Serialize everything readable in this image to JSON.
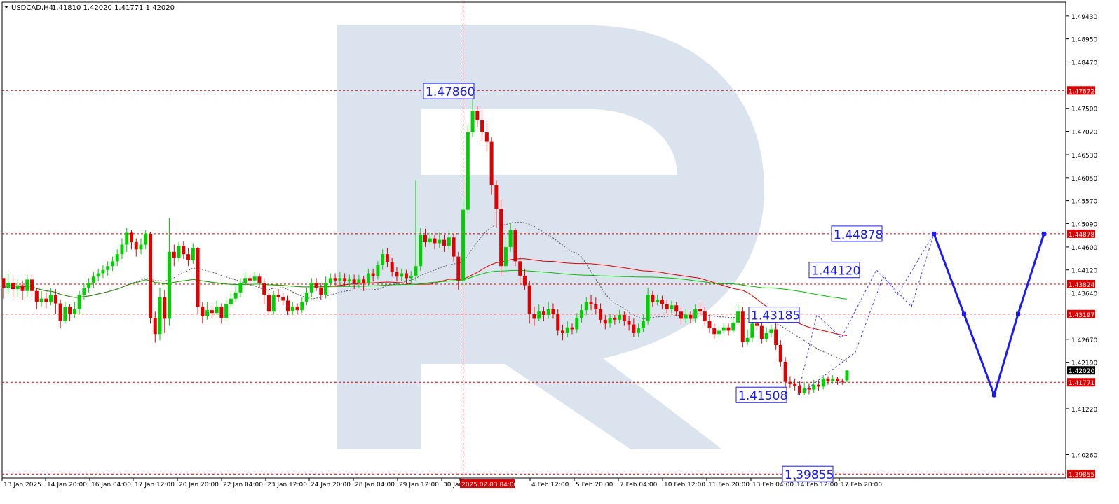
{
  "header": {
    "symbol": "USDCAD,H4",
    "ohlc": "1.41810 1.42020 1.41771 1.42020"
  },
  "chart_data": {
    "type": "candlestick",
    "symbol": "USDCAD",
    "timeframe": "H4",
    "ylim": [
      1.3977,
      1.4972
    ],
    "grid": false,
    "y_ticks": [
      "1.49430",
      "1.48950",
      "1.48470",
      "1.47500",
      "1.47020",
      "1.46530",
      "1.46050",
      "1.45570",
      "1.45090",
      "1.44600",
      "1.44120",
      "1.43640",
      "1.42670",
      "1.42190",
      "1.41220",
      "1.40260"
    ],
    "x_ticks": [
      "13 Jan 2025",
      "14 Jan 20:00",
      "16 Jan 04:00",
      "17 Jan 12:00",
      "20 Jan 20:00",
      "22 Jan 04:00",
      "23 Jan 12:00",
      "24 Jan 20:00",
      "28 Jan 04:00",
      "29 Jan 12:00",
      "30 Jan 20:00",
      "2025.02.03 04:00",
      "4 Feb 12:00",
      "5 Feb 20:00",
      "7 Feb 04:00",
      "10 Feb 12:00",
      "11 Feb 20:00",
      "13 Feb 04:00",
      "14 Feb 12:00",
      "17 Feb 20:00"
    ],
    "crosshair_time": "2025.02.03 04:00",
    "horizontal_levels": [
      {
        "value": 1.47872,
        "label": "1.47872",
        "color": "#e00000"
      },
      {
        "value": 1.44878,
        "label": "1.44878",
        "color": "#e00000"
      },
      {
        "value": 1.43824,
        "label": "1.43824",
        "color": "#e00000"
      },
      {
        "value": 1.43197,
        "label": "1.43197",
        "color": "#e00000"
      },
      {
        "value": 1.41771,
        "label": "1.41771",
        "color": "#e00000"
      },
      {
        "value": 1.39855,
        "label": "1.39855",
        "color": "#e00000"
      }
    ],
    "current_price": {
      "value": 1.4202,
      "label": "1.42020"
    },
    "annotations": [
      {
        "text": "1.47860",
        "value": 1.4786
      },
      {
        "text": "1.44878",
        "value": 1.44878
      },
      {
        "text": "1.44120",
        "value": 1.4412
      },
      {
        "text": "1.43185",
        "value": 1.43185
      },
      {
        "text": "1.41508",
        "value": 1.41508
      },
      {
        "text": "1.39855",
        "value": 1.39855
      }
    ],
    "forecast_path": [
      1.41508,
      1.44878,
      1.43197,
      1.41508,
      1.43197,
      1.44878
    ],
    "candles": [
      [
        1.4395,
        1.4375,
        1.4395,
        1.4352
      ],
      [
        1.4375,
        1.4385,
        1.4405,
        1.4362
      ],
      [
        1.4385,
        1.4372,
        1.4398,
        1.4355
      ],
      [
        1.4372,
        1.438,
        1.4393,
        1.4355
      ],
      [
        1.438,
        1.4368,
        1.439,
        1.435
      ],
      [
        1.4368,
        1.4392,
        1.4402,
        1.4355
      ],
      [
        1.4392,
        1.4368,
        1.4403,
        1.4355
      ],
      [
        1.4368,
        1.4345,
        1.4375,
        1.433
      ],
      [
        1.4345,
        1.4352,
        1.4368,
        1.4335
      ],
      [
        1.4352,
        1.4345,
        1.4365,
        1.4332
      ],
      [
        1.4345,
        1.436,
        1.4375,
        1.4338
      ],
      [
        1.436,
        1.4342,
        1.4372,
        1.432
      ],
      [
        1.4342,
        1.4305,
        1.435,
        1.429
      ],
      [
        1.4305,
        1.4335,
        1.4345,
        1.43
      ],
      [
        1.4335,
        1.432,
        1.434,
        1.4305
      ],
      [
        1.432,
        1.433,
        1.4345,
        1.4312
      ],
      [
        1.433,
        1.436,
        1.4368,
        1.432
      ],
      [
        1.436,
        1.4375,
        1.4385,
        1.435
      ],
      [
        1.4375,
        1.4385,
        1.4395,
        1.4365
      ],
      [
        1.4385,
        1.4398,
        1.4408,
        1.4375
      ],
      [
        1.4398,
        1.4405,
        1.4415,
        1.4388
      ],
      [
        1.4405,
        1.4412,
        1.4422,
        1.4395
      ],
      [
        1.4412,
        1.442,
        1.443,
        1.44
      ],
      [
        1.442,
        1.443,
        1.444,
        1.441
      ],
      [
        1.443,
        1.4445,
        1.4455,
        1.442
      ],
      [
        1.4445,
        1.4465,
        1.4478,
        1.4435
      ],
      [
        1.4465,
        1.449,
        1.45,
        1.445
      ],
      [
        1.449,
        1.447,
        1.4495,
        1.4455
      ],
      [
        1.447,
        1.4455,
        1.4478,
        1.444
      ],
      [
        1.4455,
        1.4465,
        1.4478,
        1.4445
      ],
      [
        1.4465,
        1.4488,
        1.4495,
        1.4455
      ],
      [
        1.4488,
        1.4312,
        1.4492,
        1.43
      ],
      [
        1.4312,
        1.4278,
        1.4325,
        1.426
      ],
      [
        1.4278,
        1.4355,
        1.4375,
        1.4265
      ],
      [
        1.4355,
        1.431,
        1.437,
        1.428
      ],
      [
        1.431,
        1.445,
        1.452,
        1.4295
      ],
      [
        1.445,
        1.4438,
        1.4465,
        1.442
      ],
      [
        1.4438,
        1.4462,
        1.447,
        1.443
      ],
      [
        1.4462,
        1.4445,
        1.4472,
        1.4435
      ],
      [
        1.4445,
        1.4432,
        1.4458,
        1.442
      ],
      [
        1.4432,
        1.4458,
        1.4468,
        1.4425
      ],
      [
        1.4458,
        1.4335,
        1.446,
        1.432
      ],
      [
        1.4335,
        1.4315,
        1.4345,
        1.43
      ],
      [
        1.4315,
        1.4328,
        1.4345,
        1.4308
      ],
      [
        1.4328,
        1.4322,
        1.4338,
        1.431
      ],
      [
        1.4322,
        1.4335,
        1.4348,
        1.4318
      ],
      [
        1.4335,
        1.4312,
        1.4342,
        1.43
      ],
      [
        1.4312,
        1.434,
        1.435,
        1.4305
      ],
      [
        1.434,
        1.4352,
        1.4365,
        1.4335
      ],
      [
        1.4352,
        1.4365,
        1.4378,
        1.4345
      ],
      [
        1.4365,
        1.4385,
        1.4395,
        1.4355
      ],
      [
        1.4385,
        1.4395,
        1.4408,
        1.4378
      ],
      [
        1.4395,
        1.439,
        1.4402,
        1.438
      ],
      [
        1.439,
        1.4398,
        1.4408,
        1.4382
      ],
      [
        1.4398,
        1.4385,
        1.4405,
        1.4375
      ],
      [
        1.4385,
        1.436,
        1.4395,
        1.434
      ],
      [
        1.436,
        1.4325,
        1.437,
        1.4315
      ],
      [
        1.4325,
        1.436,
        1.4368,
        1.4318
      ],
      [
        1.436,
        1.4355,
        1.4372,
        1.4345
      ],
      [
        1.4355,
        1.4348,
        1.4365,
        1.4338
      ],
      [
        1.4348,
        1.4325,
        1.4358,
        1.4318
      ],
      [
        1.4325,
        1.4335,
        1.4345,
        1.4318
      ],
      [
        1.4335,
        1.4328,
        1.4342,
        1.432
      ],
      [
        1.4328,
        1.4345,
        1.4355,
        1.4322
      ],
      [
        1.4345,
        1.4365,
        1.4375,
        1.4338
      ],
      [
        1.4365,
        1.4385,
        1.4395,
        1.4355
      ],
      [
        1.4385,
        1.4375,
        1.4395,
        1.4368
      ],
      [
        1.4375,
        1.436,
        1.4385,
        1.435
      ],
      [
        1.436,
        1.4385,
        1.4398,
        1.4352
      ],
      [
        1.4385,
        1.4395,
        1.4405,
        1.4378
      ],
      [
        1.4395,
        1.439,
        1.4405,
        1.438
      ],
      [
        1.439,
        1.4395,
        1.4408,
        1.4382
      ],
      [
        1.4395,
        1.4388,
        1.4405,
        1.4378
      ],
      [
        1.4388,
        1.4392,
        1.4402,
        1.4378
      ],
      [
        1.4392,
        1.4385,
        1.4402,
        1.4372
      ],
      [
        1.4385,
        1.4392,
        1.4402,
        1.4375
      ],
      [
        1.4392,
        1.4385,
        1.44,
        1.4368
      ],
      [
        1.4385,
        1.4405,
        1.4415,
        1.4378
      ],
      [
        1.4405,
        1.44,
        1.4415,
        1.4388
      ],
      [
        1.44,
        1.4422,
        1.443,
        1.4392
      ],
      [
        1.4422,
        1.4445,
        1.4455,
        1.4412
      ],
      [
        1.4445,
        1.4428,
        1.4458,
        1.4418
      ],
      [
        1.4428,
        1.4408,
        1.4438,
        1.4398
      ],
      [
        1.4408,
        1.4398,
        1.4418,
        1.4388
      ],
      [
        1.4398,
        1.4405,
        1.4415,
        1.4388
      ],
      [
        1.4405,
        1.4395,
        1.4412,
        1.4382
      ],
      [
        1.4395,
        1.44,
        1.441,
        1.4385
      ],
      [
        1.44,
        1.442,
        1.46,
        1.439
      ],
      [
        1.442,
        1.4485,
        1.45,
        1.441
      ],
      [
        1.4485,
        1.447,
        1.4498,
        1.446
      ],
      [
        1.447,
        1.4478,
        1.449,
        1.4465
      ],
      [
        1.4478,
        1.4468,
        1.4485,
        1.4455
      ],
      [
        1.4468,
        1.4475,
        1.449,
        1.4458
      ],
      [
        1.4475,
        1.4462,
        1.4485,
        1.445
      ],
      [
        1.4462,
        1.448,
        1.4495,
        1.4455
      ],
      [
        1.448,
        1.444,
        1.4488,
        1.443
      ],
      [
        1.444,
        1.439,
        1.445,
        1.437
      ],
      [
        1.439,
        1.4538,
        1.456,
        1.438
      ],
      [
        1.4538,
        1.47,
        1.4715,
        1.453
      ],
      [
        1.47,
        1.4745,
        1.4786,
        1.469
      ],
      [
        1.4745,
        1.4725,
        1.4755,
        1.471
      ],
      [
        1.4725,
        1.47,
        1.4748,
        1.468
      ],
      [
        1.47,
        1.468,
        1.472,
        1.466
      ],
      [
        1.468,
        1.459,
        1.469,
        1.457
      ],
      [
        1.459,
        1.454,
        1.46,
        1.45
      ],
      [
        1.454,
        1.442,
        1.456,
        1.44
      ],
      [
        1.442,
        1.446,
        1.448,
        1.441
      ],
      [
        1.446,
        1.4495,
        1.451,
        1.445
      ],
      [
        1.4495,
        1.443,
        1.45,
        1.442
      ],
      [
        1.443,
        1.44,
        1.444,
        1.438
      ],
      [
        1.44,
        1.438,
        1.4415,
        1.437
      ],
      [
        1.438,
        1.432,
        1.439,
        1.43
      ],
      [
        1.432,
        1.431,
        1.4335,
        1.4295
      ],
      [
        1.431,
        1.4325,
        1.434,
        1.4305
      ],
      [
        1.4325,
        1.4318,
        1.4335,
        1.4305
      ],
      [
        1.4318,
        1.433,
        1.4345,
        1.431
      ],
      [
        1.433,
        1.432,
        1.4342,
        1.431
      ],
      [
        1.432,
        1.4285,
        1.433,
        1.4275
      ],
      [
        1.4285,
        1.428,
        1.4298,
        1.4265
      ],
      [
        1.428,
        1.4292,
        1.4305,
        1.4272
      ],
      [
        1.4292,
        1.4288,
        1.43,
        1.4278
      ],
      [
        1.4288,
        1.4312,
        1.4322,
        1.428
      ],
      [
        1.4312,
        1.4328,
        1.434,
        1.4302
      ],
      [
        1.4328,
        1.4345,
        1.4355,
        1.4318
      ],
      [
        1.4345,
        1.434,
        1.436,
        1.4328
      ],
      [
        1.434,
        1.433,
        1.4355,
        1.432
      ],
      [
        1.433,
        1.4308,
        1.4342,
        1.43
      ],
      [
        1.4308,
        1.43,
        1.4318,
        1.4288
      ],
      [
        1.43,
        1.4312,
        1.432,
        1.4292
      ],
      [
        1.4312,
        1.4308,
        1.4318,
        1.4298
      ],
      [
        1.4308,
        1.4318,
        1.4328,
        1.43
      ],
      [
        1.4318,
        1.4305,
        1.4325,
        1.4295
      ],
      [
        1.4305,
        1.4298,
        1.4315,
        1.4285
      ],
      [
        1.4298,
        1.428,
        1.431,
        1.4272
      ],
      [
        1.428,
        1.429,
        1.43,
        1.4272
      ],
      [
        1.429,
        1.4305,
        1.4318,
        1.4282
      ],
      [
        1.4305,
        1.436,
        1.4375,
        1.4298
      ],
      [
        1.436,
        1.4345,
        1.4368,
        1.4335
      ],
      [
        1.4345,
        1.435,
        1.436,
        1.4338
      ],
      [
        1.435,
        1.434,
        1.4358,
        1.433
      ],
      [
        1.434,
        1.433,
        1.435,
        1.4322
      ],
      [
        1.433,
        1.4338,
        1.4348,
        1.4322
      ],
      [
        1.4338,
        1.4325,
        1.4345,
        1.4315
      ],
      [
        1.4325,
        1.431,
        1.4335,
        1.43
      ],
      [
        1.431,
        1.4318,
        1.433,
        1.4302
      ],
      [
        1.4318,
        1.431,
        1.4325,
        1.43
      ],
      [
        1.431,
        1.433,
        1.434,
        1.4302
      ],
      [
        1.433,
        1.4325,
        1.4345,
        1.4315
      ],
      [
        1.4325,
        1.4305,
        1.4335,
        1.4295
      ],
      [
        1.4305,
        1.429,
        1.4315,
        1.428
      ],
      [
        1.429,
        1.4278,
        1.43,
        1.4268
      ],
      [
        1.4278,
        1.4285,
        1.4295,
        1.427
      ],
      [
        1.4285,
        1.4292,
        1.4302,
        1.4278
      ],
      [
        1.4292,
        1.4285,
        1.43,
        1.4275
      ],
      [
        1.4285,
        1.4302,
        1.4312,
        1.428
      ],
      [
        1.4302,
        1.4325,
        1.434,
        1.4295
      ],
      [
        1.4325,
        1.4262,
        1.4335,
        1.425
      ],
      [
        1.4262,
        1.427,
        1.4288,
        1.4255
      ],
      [
        1.427,
        1.43,
        1.431,
        1.4262
      ],
      [
        1.43,
        1.4295,
        1.4312,
        1.4285
      ],
      [
        1.4295,
        1.4268,
        1.4305,
        1.4258
      ],
      [
        1.4268,
        1.428,
        1.4292,
        1.4262
      ],
      [
        1.428,
        1.4288,
        1.4298,
        1.4272
      ],
      [
        1.4288,
        1.4255,
        1.43,
        1.4245
      ],
      [
        1.4255,
        1.422,
        1.4265,
        1.421
      ],
      [
        1.422,
        1.4178,
        1.423,
        1.4165
      ],
      [
        1.4178,
        1.4175,
        1.419,
        1.4165
      ],
      [
        1.4175,
        1.417,
        1.4185,
        1.416
      ],
      [
        1.417,
        1.4155,
        1.418,
        1.415
      ],
      [
        1.4155,
        1.4165,
        1.4178,
        1.415
      ],
      [
        1.4165,
        1.4162,
        1.4175,
        1.4152
      ],
      [
        1.4162,
        1.4172,
        1.4182,
        1.4155
      ],
      [
        1.4172,
        1.4168,
        1.418,
        1.416
      ],
      [
        1.4168,
        1.4185,
        1.4192,
        1.4162
      ],
      [
        1.4185,
        1.418,
        1.419,
        1.4172
      ],
      [
        1.418,
        1.4185,
        1.4192,
        1.4175
      ],
      [
        1.4185,
        1.418,
        1.4188,
        1.4172
      ],
      [
        1.418,
        1.4178,
        1.4185,
        1.4172
      ],
      [
        1.4181,
        1.4202,
        1.4202,
        1.41771
      ]
    ]
  }
}
